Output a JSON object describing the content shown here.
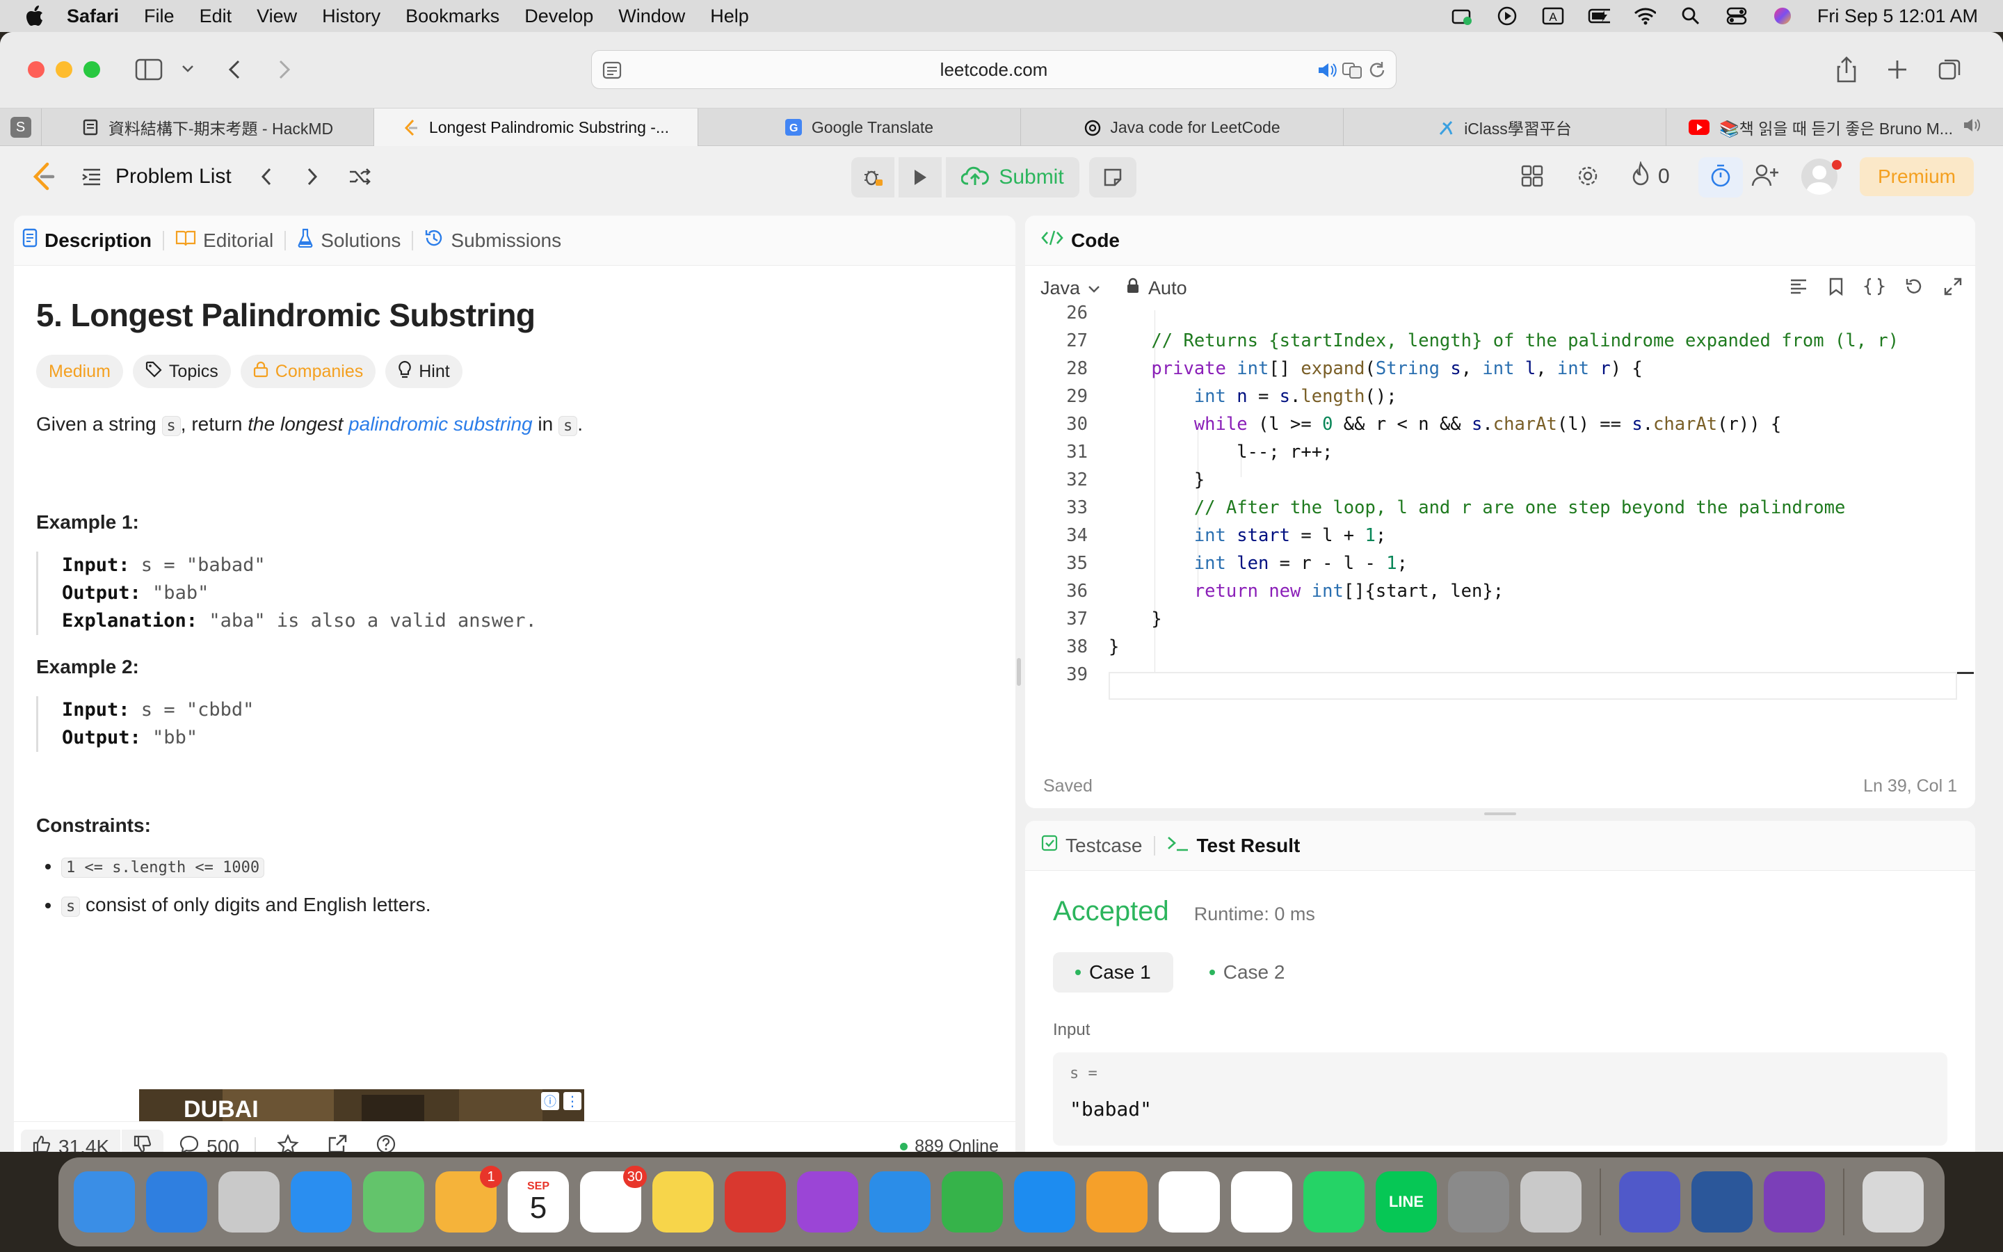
{
  "menubar": {
    "app": "Safari",
    "items": [
      "File",
      "Edit",
      "View",
      "History",
      "Bookmarks",
      "Develop",
      "Window",
      "Help"
    ],
    "clock": "Fri Sep 5  12:01 AM"
  },
  "browser": {
    "url": "leetcode.com",
    "tabs": [
      {
        "title": "資料結構下-期末考題 - HackMD",
        "icon": "hackmd-icon",
        "color": "#333333"
      },
      {
        "title": "Longest Palindromic Substring -...",
        "icon": "leetcode-icon",
        "color": "#f89f1b"
      },
      {
        "title": "Google Translate",
        "icon": "google-translate-icon",
        "color": "#4285f4"
      },
      {
        "title": "Java code for LeetCode",
        "icon": "openai-icon",
        "color": "#111111"
      },
      {
        "title": "iClass學習平台",
        "icon": "iclass-icon",
        "color": "#3aa0e0"
      },
      {
        "title": "📚책 읽을 때 듣기 좋은 Bruno M...",
        "icon": "youtube-icon",
        "color": "#ff0000"
      }
    ]
  },
  "lcnav": {
    "problem_list": "Problem List",
    "submit": "Submit",
    "streak": "0",
    "premium": "Premium"
  },
  "left": {
    "tabs": [
      "Description",
      "Editorial",
      "Solutions",
      "Submissions"
    ],
    "title": "5. Longest Palindromic Substring",
    "chips": {
      "difficulty": "Medium",
      "topics": "Topics",
      "companies": "Companies",
      "hint": "Hint"
    },
    "statement": {
      "p1": "Given a string ",
      "s1": "s",
      "p2": ", return ",
      "p3": "the longest ",
      "link": "palindromic substring",
      "p4": " in ",
      "s2": "s",
      "p5": "."
    },
    "ex1": {
      "heading": "Example 1:",
      "input_label": "Input:",
      "input": " s = \"babad\"",
      "output_label": "Output:",
      "output": " \"bab\"",
      "expl_label": "Explanation:",
      "expl": " \"aba\" is also a valid answer."
    },
    "ex2": {
      "heading": "Example 2:",
      "input_label": "Input:",
      "input": " s = \"cbbd\"",
      "output_label": "Output:",
      "output": " \"bb\""
    },
    "constraints": {
      "heading": "Constraints:",
      "c1": "1 <= s.length <= 1000",
      "c2_code": "s",
      "c2_text": " consist of only digits and English letters."
    },
    "footer": {
      "likes": "31.4K",
      "comments": "500",
      "online": "889 Online"
    },
    "ad_text": "DUBAI"
  },
  "code": {
    "header": "Code",
    "language": "Java",
    "mode": "Auto",
    "saved": "Saved",
    "position": "Ln 39, Col 1",
    "lines": [
      {
        "n": "26",
        "html": ""
      },
      {
        "n": "27",
        "html": "    <span class='cm'>// Returns {startIndex, length} of the palindrome expanded from (l, r)</span>"
      },
      {
        "n": "28",
        "html": "    <span class='kw'>private</span> <span class='ty'>int</span>[] <span class='fn'>expand</span>(<span class='ty'>String</span> <span class='id'>s</span>, <span class='ty'>int</span> <span class='id'>l</span>, <span class='ty'>int</span> <span class='id'>r</span>) {"
      },
      {
        "n": "29",
        "html": "        <span class='ty'>int</span> <span class='id'>n</span> = <span class='id'>s</span>.<span class='fn'>length</span>();"
      },
      {
        "n": "30",
        "html": "        <span class='kw'>while</span> (l &gt;= <span class='num'>0</span> &amp;&amp; r &lt; n &amp;&amp; <span class='id'>s</span>.<span class='fn'>charAt</span>(l) == <span class='id'>s</span>.<span class='fn'>charAt</span>(r)) {"
      },
      {
        "n": "31",
        "html": "            l--; r++;"
      },
      {
        "n": "32",
        "html": "        }"
      },
      {
        "n": "33",
        "html": "        <span class='cm'>// After the loop, l and r are one step beyond the palindrome</span>"
      },
      {
        "n": "34",
        "html": "        <span class='ty'>int</span> <span class='id'>start</span> = l + <span class='num'>1</span>;"
      },
      {
        "n": "35",
        "html": "        <span class='ty'>int</span> <span class='id'>len</span> = r - l - <span class='num'>1</span>;"
      },
      {
        "n": "36",
        "html": "        <span class='kw'>return</span> <span class='kw'>new</span> <span class='ty'>int</span>[]{start, len};"
      },
      {
        "n": "37",
        "html": "    }"
      },
      {
        "n": "38",
        "html": "}"
      },
      {
        "n": "39",
        "html": ""
      }
    ]
  },
  "result": {
    "tabs": [
      "Testcase",
      "Test Result"
    ],
    "status": "Accepted",
    "runtime": "Runtime: 0 ms",
    "cases": [
      "Case 1",
      "Case 2"
    ],
    "input_label": "Input",
    "var": "s =",
    "value": "\"babad\""
  },
  "dock": [
    {
      "name": "finder",
      "color": "#3a8ee6"
    },
    {
      "name": "mail",
      "color": "#2f7fe0"
    },
    {
      "name": "launchpad",
      "color": "#c9c9c9"
    },
    {
      "name": "safari",
      "color": "#2a8ef0"
    },
    {
      "name": "maps",
      "color": "#63c46b"
    },
    {
      "name": "photos",
      "color": "#f5b33a",
      "badge": "1"
    },
    {
      "name": "calendar",
      "color": "#ffffff",
      "label": "5",
      "month": "SEP"
    },
    {
      "name": "reminders",
      "color": "#ffffff",
      "badge": "30"
    },
    {
      "name": "notes",
      "color": "#f7d54a"
    },
    {
      "name": "photo-booth",
      "color": "#d9382f"
    },
    {
      "name": "podcasts",
      "color": "#9b45d6"
    },
    {
      "name": "keynote",
      "color": "#2b8de8"
    },
    {
      "name": "numbers",
      "color": "#36b34a"
    },
    {
      "name": "app-store",
      "color": "#1d8cf0"
    },
    {
      "name": "pages",
      "color": "#f5a02a"
    },
    {
      "name": "chrome",
      "color": "#ffffff"
    },
    {
      "name": "iclass",
      "color": "#ffffff"
    },
    {
      "name": "whatsapp",
      "color": "#25d366"
    },
    {
      "name": "line",
      "color": "#06c755",
      "label": "LINE"
    },
    {
      "name": "system-settings",
      "color": "#8a8a8a"
    },
    {
      "name": "iphone-mirroring",
      "color": "#c9c9c9"
    },
    {
      "name": "teams",
      "color": "#5059c9"
    },
    {
      "name": "word",
      "color": "#2b579a"
    },
    {
      "name": "github-desktop",
      "color": "#7b3fb8"
    },
    {
      "name": "trash",
      "color": "#d8d8d8"
    }
  ]
}
